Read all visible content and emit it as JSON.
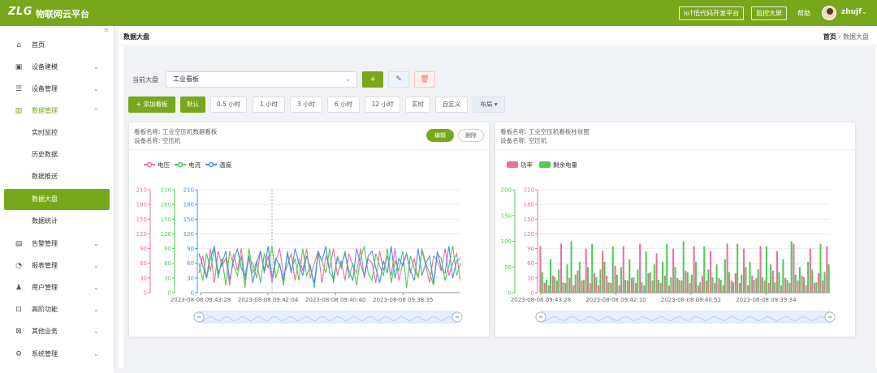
{
  "header": {
    "logo": "ZLG",
    "brand": "物联网云平台",
    "buttons": [
      "IoT低代码开发平台",
      "监控大屏"
    ],
    "help": "帮助",
    "user": "zhujf",
    "user_chevron": "⌄"
  },
  "sidebar": {
    "collapse_icon": "≡",
    "items": [
      {
        "label": "首页",
        "icon": "home-icon",
        "glyph": "⌂",
        "chevron": ""
      },
      {
        "label": "设备建模",
        "icon": "model-icon",
        "glyph": "▣",
        "chevron": "⌄"
      },
      {
        "label": "设备管理",
        "icon": "device-icon",
        "glyph": "☰",
        "chevron": "⌄"
      },
      {
        "label": "数据管理",
        "icon": "chart-bar-icon",
        "glyph": "▥",
        "chevron": "⌃",
        "active": true
      },
      {
        "label": "告警管理",
        "icon": "alert-icon",
        "glyph": "▤",
        "chevron": "⌄"
      },
      {
        "label": "报表管理",
        "icon": "report-icon",
        "glyph": "◔",
        "chevron": "⌄"
      },
      {
        "label": "用户管理",
        "icon": "user-icon",
        "glyph": "♟",
        "chevron": "⌄"
      },
      {
        "label": "高阶功能",
        "icon": "toolbox-icon",
        "glyph": "⊡",
        "chevron": "⌄"
      },
      {
        "label": "其他业务",
        "icon": "other-icon",
        "glyph": "⊠",
        "chevron": "⌄"
      },
      {
        "label": "系统管理",
        "icon": "gear-icon",
        "glyph": "⚙",
        "chevron": "⌄"
      }
    ],
    "sub_items": [
      "实时监控",
      "历史数据",
      "数据推送",
      "数据大盘",
      "数据统计"
    ],
    "active_sub": "数据大盘"
  },
  "page": {
    "title": "数据大盘",
    "breadcrumb_home": "首页",
    "breadcrumb_sep": "›",
    "breadcrumb_current": "数据大盘"
  },
  "toolbar": {
    "current_label": "当前大盘",
    "board_value": "工业看板",
    "select_chevron": "⌄",
    "add_icon": "+",
    "edit_icon": "✎",
    "delete_icon": "🗑",
    "add_board": "+ 添加看板",
    "ranges": [
      "默认",
      "0.5 小时",
      "1 小时",
      "3 小时",
      "6 小时",
      "12 小时",
      "实时",
      "自定义"
    ],
    "layout": "布局 ▾"
  },
  "colors": {
    "accent": "#77a81c",
    "voltage": "#ed6ea0",
    "current": "#4fcc56",
    "temperature": "#4a90e2",
    "power": "#ed6ea0",
    "remaining": "#4fcc56"
  },
  "cards": [
    {
      "board_name_label": "看板名称:",
      "board_name": "工业空压机数据看板",
      "device_label": "设备名称:",
      "device_name": "空压机",
      "edit": "编辑",
      "delete": "删除"
    },
    {
      "board_name_label": "看板名称:",
      "board_name": "工业空压机看板柱状图",
      "device_label": "设备名称:",
      "device_name": "空压机"
    }
  ],
  "chart_data": [
    {
      "type": "line",
      "legend": [
        "电压",
        "电流",
        "温度"
      ],
      "y_axes": [
        {
          "ticks": [
            0,
            30,
            60,
            90,
            120,
            150,
            180,
            210
          ],
          "color": "#4a90e2"
        },
        {
          "ticks": [
            0,
            30,
            60,
            90,
            120,
            150,
            180,
            210
          ],
          "color": "#4fcc56"
        },
        {
          "ticks": [
            0,
            30,
            60,
            90,
            120,
            150,
            180,
            210
          ],
          "color": "#ed6ea0"
        }
      ],
      "ylim": [
        0,
        210
      ],
      "x_tick_labels": [
        "2023-08-08 09:43:28",
        "2023-08-08 09:42:04",
        "2023-08-08 09:40:40",
        "2023-08-08 09:38:35"
      ],
      "series": [
        {
          "name": "电压",
          "values": [
            40,
            75,
            30,
            90,
            20,
            85,
            55,
            70,
            15,
            80,
            45,
            90,
            25,
            70,
            60,
            30,
            85,
            40,
            75,
            20,
            65,
            90,
            35,
            55,
            80,
            25,
            70,
            45,
            90,
            30,
            60,
            85,
            20,
            75,
            50,
            90,
            35,
            65,
            25,
            80,
            55,
            40,
            90,
            30,
            70,
            60,
            20,
            85,
            45,
            75,
            35,
            90,
            25,
            60,
            80,
            40,
            70,
            30,
            85,
            55,
            20,
            75,
            65,
            45,
            90,
            35,
            60,
            80,
            25
          ]
        },
        {
          "name": "电流",
          "values": [
            60,
            25,
            80,
            45,
            90,
            30,
            70,
            15,
            85,
            55,
            35,
            75,
            10,
            90,
            40,
            65,
            20,
            80,
            50,
            95,
            30,
            60,
            15,
            85,
            45,
            70,
            25,
            90,
            35,
            55,
            10,
            80,
            65,
            40,
            90,
            20,
            75,
            50,
            85,
            30,
            60,
            15,
            70,
            95,
            40,
            25,
            80,
            55,
            35,
            90,
            20,
            65,
            45,
            85,
            10,
            75,
            50,
            30,
            90,
            60,
            40,
            15,
            80,
            70,
            25,
            55,
            95,
            35,
            60
          ]
        },
        {
          "name": "温度",
          "values": [
            80,
            55,
            30,
            70,
            95,
            40,
            60,
            85,
            25,
            65,
            90,
            50,
            35,
            75,
            20,
            60,
            85,
            45,
            95,
            30,
            70,
            55,
            25,
            80,
            40,
            90,
            60,
            35,
            75,
            50,
            20,
            85,
            65,
            95,
            40,
            30,
            70,
            55,
            80,
            45,
            25,
            90,
            60,
            35,
            75,
            85,
            50,
            20,
            65,
            40,
            95,
            30,
            70,
            55,
            80,
            45,
            25,
            90,
            35,
            60,
            75,
            20,
            85,
            50,
            40,
            95,
            30,
            65,
            70
          ]
        }
      ]
    },
    {
      "type": "bar",
      "legend": [
        "功率",
        "剩余电量"
      ],
      "y_axes": [
        {
          "ticks": [
            0,
            50,
            100,
            150,
            200
          ],
          "color": "#4fcc56"
        },
        {
          "ticks": [
            0,
            30,
            60,
            90,
            120,
            150,
            180,
            210
          ],
          "color": "#ed6ea0"
        }
      ],
      "x_tick_labels": [
        "2023-08-08 09:43:28",
        "2023-08-08 09:42:10",
        "2023-08-08 09:40:52",
        "2023-08-08 09:39:34"
      ],
      "series": [
        {
          "name": "功率",
          "axis_max": 210,
          "values": [
            95,
            20,
            15,
            35,
            25,
            100,
            20,
            30,
            15,
            45,
            25,
            90,
            20,
            40,
            15,
            85,
            35,
            20,
            55,
            15,
            95,
            25,
            30,
            20,
            100,
            15,
            40,
            25,
            80,
            20,
            35,
            15,
            90,
            30,
            25,
            45,
            20,
            95,
            15,
            35,
            25,
            85,
            20,
            30,
            15,
            100,
            25,
            40,
            20,
            90,
            15,
            35,
            30,
            95,
            25,
            20,
            45,
            85,
            15,
            30,
            20,
            100,
            25,
            35,
            15,
            90,
            20,
            40,
            25,
            95
          ]
        },
        {
          "name": "剩余电量",
          "axis_max": 200,
          "values": [
            40,
            25,
            65,
            30,
            45,
            20,
            55,
            100,
            35,
            60,
            25,
            50,
            95,
            30,
            45,
            60,
            20,
            90,
            35,
            50,
            25,
            65,
            30,
            45,
            20,
            80,
            40,
            55,
            25,
            60,
            95,
            30,
            50,
            25,
            100,
            40,
            35,
            60,
            20,
            90,
            45,
            30,
            55,
            25,
            65,
            40,
            20,
            95,
            35,
            50,
            60,
            25,
            45,
            30,
            90,
            55,
            20,
            40,
            65,
            25,
            100,
            35,
            50,
            30,
            60,
            45,
            20,
            95,
            40,
            55
          ]
        }
      ]
    }
  ]
}
